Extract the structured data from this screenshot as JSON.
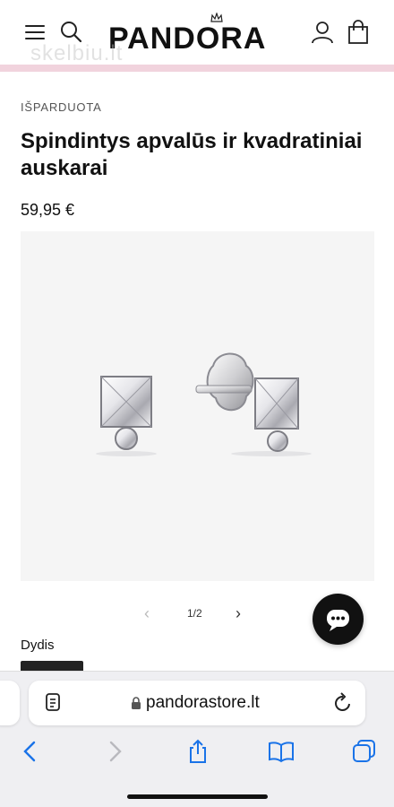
{
  "header": {
    "brand": "PANDORA",
    "watermark": "skelbiu.lt",
    "accent_color": "#f1d3dd",
    "icons": [
      "menu-icon",
      "search-icon",
      "crown-icon",
      "user-icon",
      "shopping-bag-icon"
    ]
  },
  "product": {
    "category": "IŠPARDUOTA",
    "title": "Spindintys apvalūs ir kvadratiniai auskarai",
    "price": "59,95 €",
    "image_alt": "Sidabriniai auskarai su kvadratiniu ir apvaliu kristalu"
  },
  "gallery": {
    "counter": "1/2",
    "prev_icon": "chevron-left-icon",
    "next_icon": "chevron-right-icon"
  },
  "size": {
    "label": "Dydis"
  },
  "browser": {
    "url": "pandorastore.lt",
    "icons": [
      "reader-icon",
      "lock-icon",
      "reload-icon",
      "back-icon",
      "forward-icon",
      "share-icon",
      "bookmarks-icon",
      "tabs-icon"
    ]
  }
}
